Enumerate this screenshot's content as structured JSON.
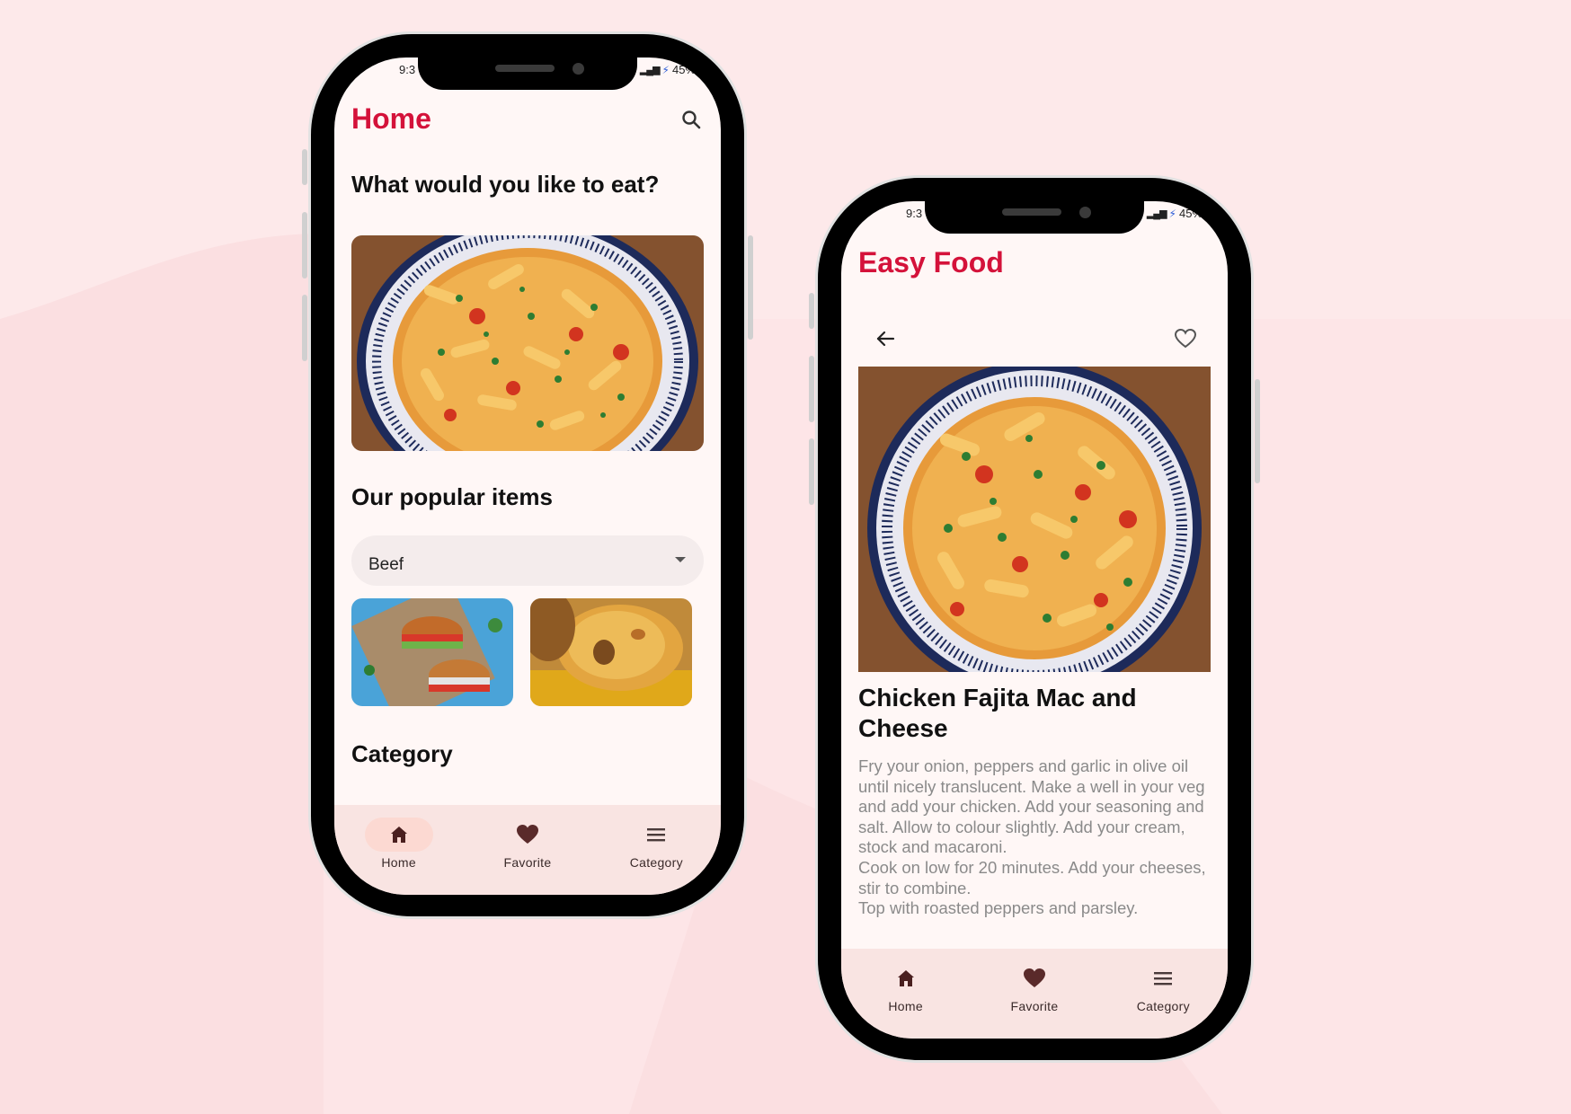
{
  "status_bar": {
    "time": "9:3",
    "battery": "45%"
  },
  "home_screen": {
    "title": "Home",
    "question": "What would you like to eat?",
    "popular_heading": "Our popular items",
    "dropdown_value": "Beef",
    "category_heading": "Category"
  },
  "detail_screen": {
    "app_title": "Easy Food",
    "recipe_title": "Chicken Fajita Mac and Cheese",
    "recipe_instructions": "Fry your onion, peppers and garlic in olive oil until nicely translucent. Make a well in your veg and add your chicken. Add your seasoning and salt. Allow to colour slightly. Add your cream, stock and macaroni.\nCook on low for 20 minutes. Add your cheeses, stir to combine.\nTop with roasted peppers and parsley."
  },
  "nav": {
    "home": "Home",
    "favorite": "Favorite",
    "category": "Category"
  },
  "colors": {
    "accent": "#d4123a",
    "background": "#fde9ea",
    "screen": "#fff7f6",
    "nav_bar": "#f9e4e2",
    "nav_active": "#fcd9d2"
  }
}
